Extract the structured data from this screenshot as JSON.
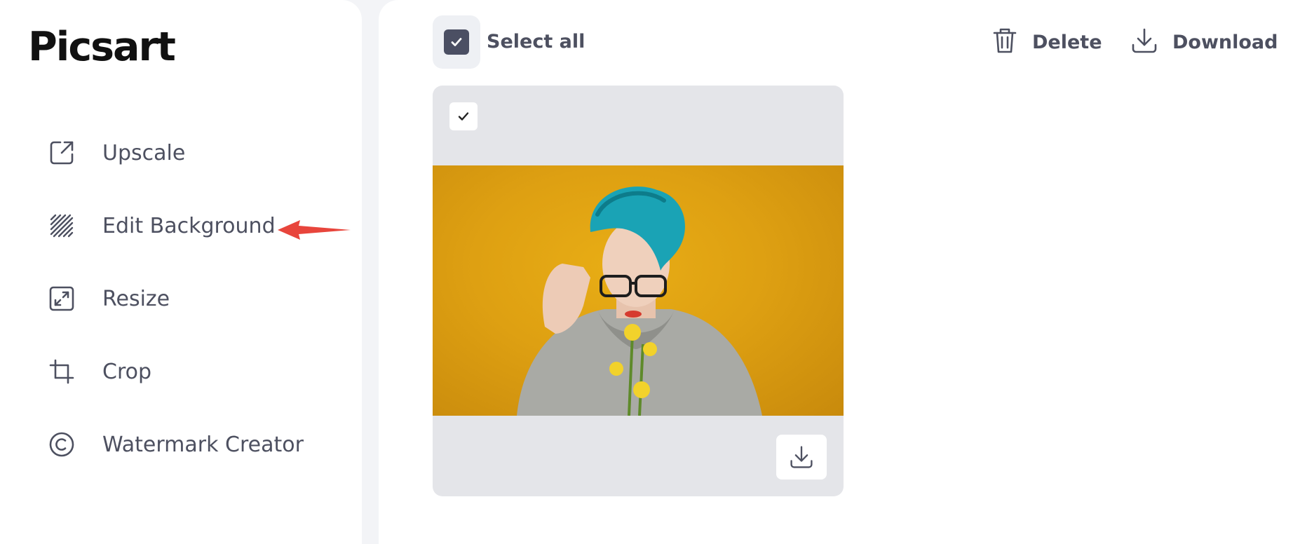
{
  "app": {
    "logo_text": "Picsart"
  },
  "sidebar": {
    "items": [
      {
        "label": "Upscale",
        "icon": "upscale-icon"
      },
      {
        "label": "Edit Background",
        "icon": "edit-background-icon"
      },
      {
        "label": "Resize",
        "icon": "resize-icon"
      },
      {
        "label": "Crop",
        "icon": "crop-icon"
      },
      {
        "label": "Watermark Creator",
        "icon": "watermark-icon"
      }
    ]
  },
  "toolbar": {
    "select_all_label": "Select all",
    "select_all_checked": true,
    "delete_label": "Delete",
    "download_label": "Download"
  },
  "gallery": {
    "items": [
      {
        "checked": true,
        "thumbnail": "portrait-photo",
        "download_icon": "download-icon"
      }
    ]
  },
  "colors": {
    "accent": "#4b4f63",
    "annotation_arrow": "#e8453c",
    "photo_background": "#dea012"
  }
}
